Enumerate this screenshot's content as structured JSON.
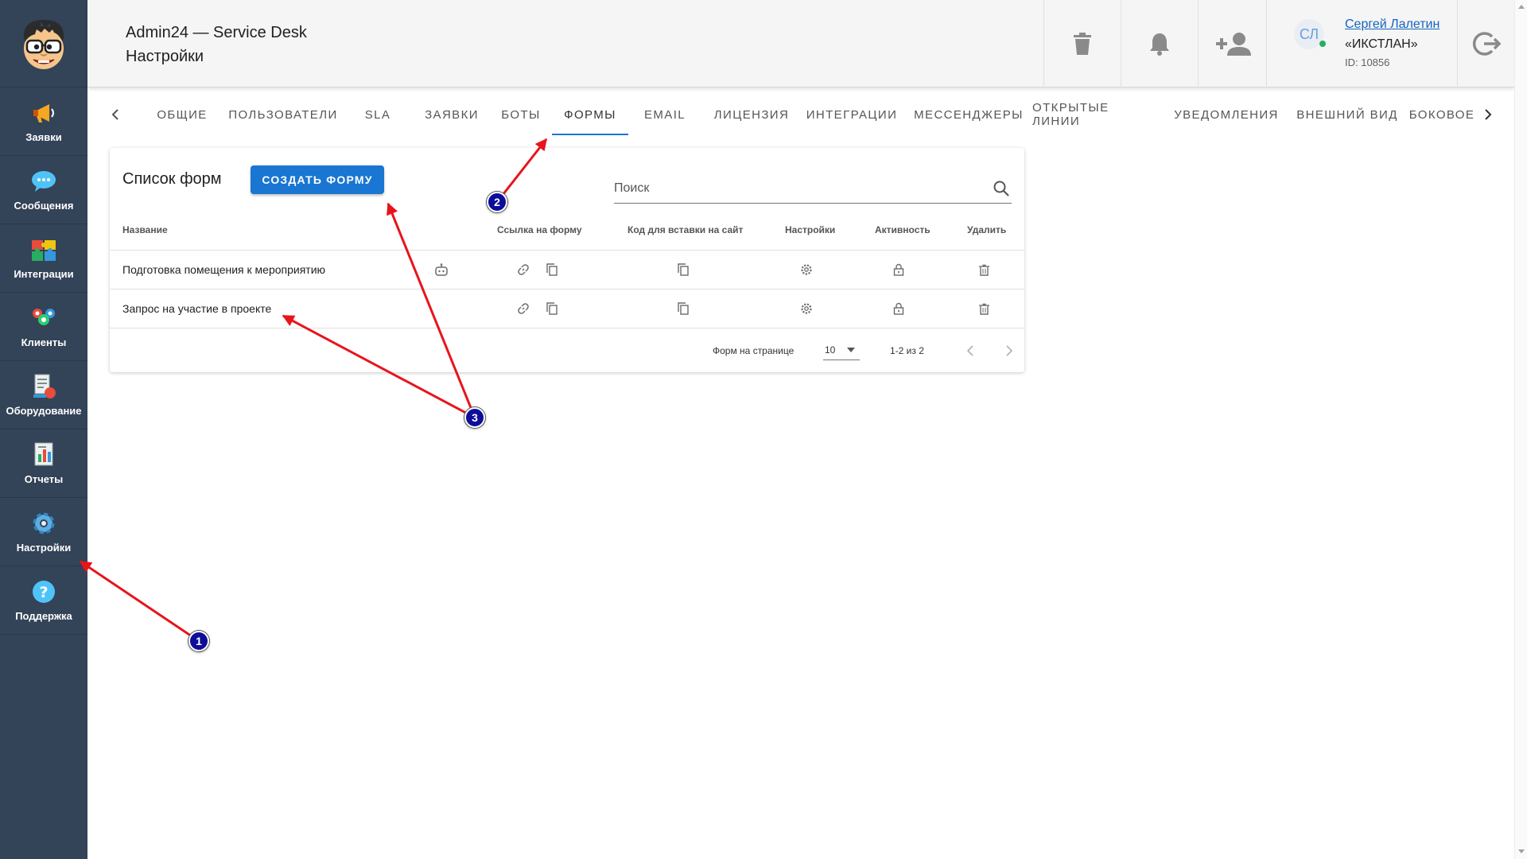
{
  "sidebar": {
    "logo_name": "cartoon-face-logo",
    "items": [
      {
        "label": "Заявки",
        "icon": "megaphone-icon"
      },
      {
        "label": "Сообщения",
        "icon": "chat-bubble-icon"
      },
      {
        "label": "Интеграции",
        "icon": "puzzle-icon"
      },
      {
        "label": "Клиенты",
        "icon": "people-icon"
      },
      {
        "label": "Оборудование",
        "icon": "equipment-icon"
      },
      {
        "label": "Отчеты",
        "icon": "report-icon"
      },
      {
        "label": "Настройки",
        "icon": "gear-icon"
      },
      {
        "label": "Поддержка",
        "icon": "help-icon"
      }
    ]
  },
  "header": {
    "app_title": "Admin24 — Service Desk",
    "page_title": "Настройки",
    "user": {
      "initials": "СЛ",
      "name": "Сергей Лалетин",
      "company": "«ИКСТЛАН»",
      "id_text": "ID: 10856"
    }
  },
  "tabs": {
    "items": [
      "ОБЩИЕ",
      "ПОЛЬЗОВАТЕЛИ",
      "SLA",
      "ЗАЯВКИ",
      "БОТЫ",
      "ФОРМЫ",
      "EMAIL",
      "ЛИЦЕНЗИЯ",
      "ИНТЕГРАЦИИ",
      "МЕССЕНДЖЕРЫ",
      "ОТКРЫТЫЕ ЛИНИИ",
      "УВЕДОМЛЕНИЯ",
      "ВНЕШНИЙ ВИД",
      "БОКОВОЕ"
    ],
    "active": "ФОРМЫ"
  },
  "forms": {
    "title": "Список форм",
    "create_button": "СОЗДАТЬ ФОРМУ",
    "search_placeholder": "Поиск",
    "columns": {
      "name": "Название",
      "link": "Ссылка на форму",
      "embed": "Код для вставки на сайт",
      "settings": "Настройки",
      "active": "Активность",
      "delete": "Удалить"
    },
    "rows": [
      {
        "name": "Подготовка помещения к мероприятию",
        "has_bot_icon": true
      },
      {
        "name": "Запрос на участие в проекте",
        "has_bot_icon": false
      }
    ],
    "pagination": {
      "per_page_label": "Форм на странице",
      "per_page_value": "10",
      "range": "1-2 из 2"
    }
  },
  "annotations": {
    "markers": [
      "1",
      "2",
      "3"
    ],
    "arrow_color": "#e8141c",
    "marker_color": "#0d0d9a"
  },
  "colors": {
    "sidebar_bg": "#334358",
    "accent": "#1976d2",
    "header_bg": "#f5f5f5"
  }
}
